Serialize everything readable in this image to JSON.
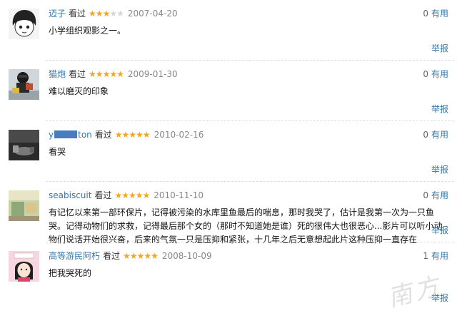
{
  "reviews": [
    {
      "user": "迈子",
      "action": "看过",
      "rating": 3,
      "date": "2007-04-20",
      "votes": "0",
      "useful": "有用",
      "comment": "小学组织观影之一。",
      "report": "举报"
    },
    {
      "user": "猫炮",
      "action": "看过",
      "rating": 5,
      "date": "2009-01-30",
      "votes": "0",
      "useful": "有用",
      "comment": "难以磨灭的印象",
      "report": "举报"
    },
    {
      "user_prefix": "y",
      "user_suffix": "ton",
      "action": "看过",
      "rating": 5,
      "date": "2010-02-16",
      "votes": "0",
      "useful": "有用",
      "comment": "看哭",
      "report": "举报"
    },
    {
      "user": "seabiscuit",
      "action": "看过",
      "rating": 5,
      "date": "2010-11-10",
      "votes": "0",
      "useful": "有用",
      "comment": "有记忆以来第一部环保片，记得被污染的水库里鱼最后的喘息，那时我哭了，估计是我第一次为一只鱼哭。记得动物们的求救，记得最后那个女的（那时不知道她是谁）死的很伟大也很恶心...影片可以听小动物们说话开始很兴奋，后来的气氛一只是压抑和紧张，十几年之后无意想起此片这种压抑一直存在",
      "report": "举报"
    },
    {
      "user": "高等游民阿朽",
      "action": "看过",
      "rating": 5,
      "date": "2008-10-09",
      "votes": "1",
      "useful": "有用",
      "comment": "把我哭死的",
      "report": "举报"
    }
  ],
  "star_glyph": "★",
  "colors": {
    "link": "#3377aa",
    "star": "#f7a51c",
    "star_off": "#d6d6d6"
  }
}
